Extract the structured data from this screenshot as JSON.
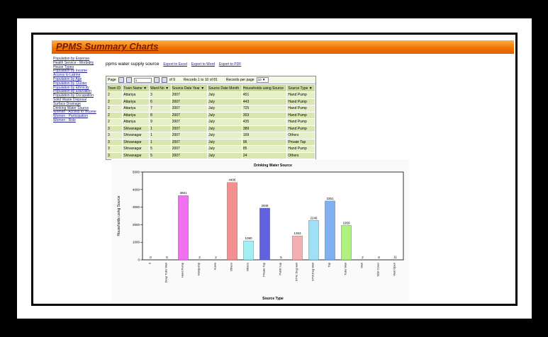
{
  "header": {
    "title": "PPMS Summary Charts"
  },
  "sidebar": {
    "items": [
      {
        "label": "Population by Expense"
      },
      {
        "label": "Health Service - Morbidity"
      },
      {
        "label": "House Types"
      },
      {
        "label": "Population by Income"
      },
      {
        "label": "Access to Latrine"
      },
      {
        "label": "Population by Age"
      },
      {
        "label": "Population by Cluster"
      },
      {
        "label": "Population by Ethnicity"
      },
      {
        "label": "Population by Education"
      },
      {
        "label": "Population by Occupation"
      },
      {
        "label": "Solid Waste Disposal"
      },
      {
        "label": "Surface Drainage"
      },
      {
        "label": "Drinking Water Source"
      },
      {
        "label": "Women - Access to Income"
      },
      {
        "label": "Women - Participation"
      },
      {
        "label": "Women - Role"
      }
    ]
  },
  "main": {
    "heading": "ppms water supply source",
    "export_excel": "Export to Excel",
    "export_word": "Export to Word",
    "export_pdf": "Export to PDF"
  },
  "pager": {
    "page_label": "Page",
    "page_value": "1",
    "of_label": "of 9",
    "records_text": "Records 1 to 10 of 81",
    "per_page_label": "Records per page",
    "per_page_value": "10 ▼"
  },
  "table": {
    "columns": [
      "Town ID",
      "Town Name ▼",
      "Ward No ▼",
      "Source Date Year ▼",
      "Source Date Month",
      "Households using Source",
      "Source Type ▼"
    ],
    "rows": [
      [
        "2",
        "Attariya",
        "3",
        "2007",
        "July",
        "451",
        "Hand Pump"
      ],
      [
        "2",
        "Attariya",
        "6",
        "2007",
        "July",
        "443",
        "Hand Pump"
      ],
      [
        "2",
        "Attariya",
        "7",
        "2007",
        "July",
        "725",
        "Hand Pump"
      ],
      [
        "2",
        "Attariya",
        "8",
        "2007",
        "July",
        "303",
        "Hand Pump"
      ],
      [
        "2",
        "Attariya",
        "9",
        "2007",
        "July",
        "435",
        "Hand Pump"
      ],
      [
        "3",
        "Shivanagar",
        "1",
        "2007",
        "July",
        "389",
        "Hand Pump"
      ],
      [
        "3",
        "Shivanagar",
        "1",
        "2007",
        "July",
        "169",
        "Others"
      ],
      [
        "3",
        "Shivanagar",
        "1",
        "2007",
        "July",
        "96",
        "Private Tap"
      ],
      [
        "3",
        "Shivanagar",
        "5",
        "2007",
        "July",
        "85",
        "Hand Pump"
      ],
      [
        "3",
        "Shivanagar",
        "5",
        "2007",
        "July",
        "24",
        "Others"
      ]
    ]
  },
  "chart_data": {
    "type": "bar",
    "title": "Drinking Water Source",
    "xlabel": "Source Type",
    "ylabel": "Households using Source",
    "ylim": [
      0,
      5000
    ],
    "yticks": [
      "0",
      "1000",
      "2000",
      "3000",
      "4000",
      "5000"
    ],
    "grid": false,
    "categories": [
      "0",
      "Deep Tube Well",
      "Hand Pump",
      "Hanipump",
      "Kuwa",
      "Others",
      "Others",
      "Private Tap",
      "Public tap",
      "STW, Dug well",
      "STW,Dug Well",
      "Tap",
      "Tube Well",
      "Well",
      "Well Cover",
      "Well Open"
    ],
    "values": [
      0,
      5,
      3661,
      2,
      2,
      4406,
      1080,
      2946,
      5,
      1363,
      2246,
      3351,
      1959,
      2,
      8,
      11
    ],
    "colors": [
      "#ffd0ff",
      "#ffa0ff",
      "#f070f0",
      "#f4b0d0",
      "#f0a0a0",
      "#f49090",
      "#a0f0f4",
      "#6060e0",
      "#a0c0ff",
      "#f4b0b0",
      "#a0e0f4",
      "#80b0f0",
      "#b0f080",
      "#c0c0c0",
      "#c0c0c0",
      "#c0c0c0"
    ]
  }
}
